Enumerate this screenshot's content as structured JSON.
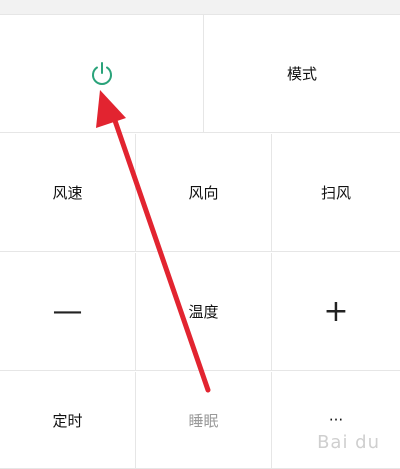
{
  "controls": {
    "power_icon": "power-icon",
    "mode_label": "模式",
    "fan_speed_label": "风速",
    "wind_direction_label": "风向",
    "swing_label": "扫风",
    "decrease_symbol": "—",
    "temperature_label": "温度",
    "increase_symbol": "+",
    "timer_label": "定时",
    "sleep_label": "睡眠",
    "more_symbol": "···"
  },
  "watermark": {
    "text": "Bai du"
  },
  "colors": {
    "power_icon": "#2aa37a",
    "arrow": "#e22430",
    "disabled_text": "#9a9a9a",
    "divider": "#e6e6e6"
  }
}
